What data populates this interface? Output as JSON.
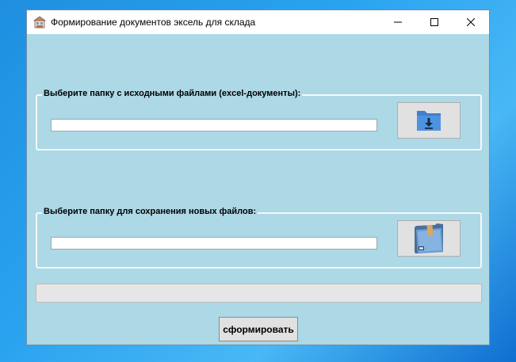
{
  "window": {
    "title": "Формирование документов эксель для склада",
    "app_icon": "warehouse-icon",
    "controls": {
      "minimize": "minimize-icon",
      "maximize": "maximize-icon",
      "close": "close-icon"
    }
  },
  "source_group": {
    "label": "Выберите папку с исходными файлами (excel-документы):",
    "path_value": "",
    "button_icon": "folder-download-icon"
  },
  "target_group": {
    "label": "Выберите папку для сохранения новых файлов:",
    "path_value": "",
    "button_icon": "folder-icon"
  },
  "progress": {
    "value": 0
  },
  "action_button": {
    "label": "сформировать"
  },
  "colors": {
    "window_background": "#add8e6",
    "button_face": "#e1e1e1",
    "folder_blue": "#4a8fd9"
  }
}
